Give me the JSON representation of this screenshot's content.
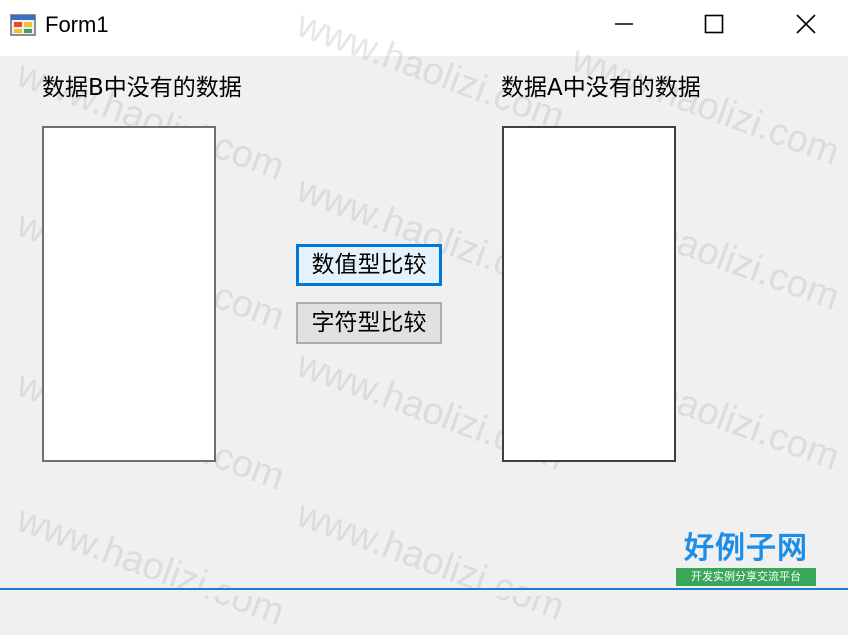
{
  "window": {
    "title": "Form1",
    "controls": {
      "minimize_icon": "minimize-icon",
      "maximize_icon": "maximize-icon",
      "close_icon": "close-icon"
    }
  },
  "form": {
    "label_left": "数据B中没有的数据",
    "label_right": "数据A中没有的数据",
    "btn_numeric": "数值型比较",
    "btn_string": "字符型比较",
    "listbox_left_items": [],
    "listbox_right_items": []
  },
  "watermark": {
    "text": "www.haolizi.com"
  },
  "logo": {
    "main": "好例子网",
    "sub": "开发实例分享交流平台"
  },
  "colors": {
    "focus_border": "#0078d7",
    "accent_line": "#1e7bd0",
    "logo_blue": "#1d8ee8",
    "logo_green": "#3aa65a"
  }
}
